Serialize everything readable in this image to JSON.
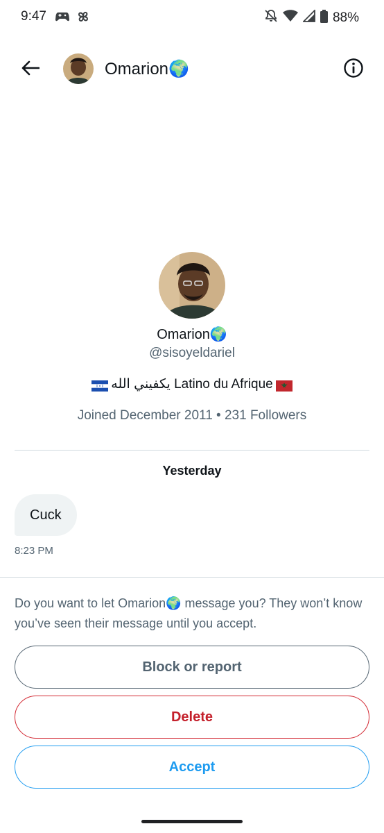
{
  "status_bar": {
    "time": "9:47",
    "battery": "88%",
    "left_icons": [
      "game-controller-icon",
      "pinwheel-icon"
    ],
    "right_icons": [
      "notifications-off-icon",
      "wifi-icon",
      "cell-signal-icon",
      "battery-icon"
    ]
  },
  "header": {
    "name": "Omarion🌍",
    "back_icon": "arrow-left-icon",
    "info_icon": "info-circle-icon"
  },
  "profile": {
    "name": "Omarion🌍",
    "handle": "@sisoyeldariel",
    "bio": "يكفيني الله Latino du Afrique",
    "bio_prefix_flag": "honduras-flag",
    "bio_suffix_flag": "morocco-flag",
    "meta": "Joined December 2011 • 231 Followers"
  },
  "conversation": {
    "date_separator": "Yesterday",
    "messages": [
      {
        "text": "Cuck",
        "time": "8:23 PM"
      }
    ]
  },
  "request": {
    "prompt": "Do you want to let Omarion🌍 message you? They won’t know you’ve seen their message until you accept.",
    "block_label": "Block or report",
    "delete_label": "Delete",
    "accept_label": "Accept"
  },
  "colors": {
    "secondary_text": "#536471",
    "danger": "#c4202b",
    "accent": "#1d9bf0",
    "bubble": "#eff3f4"
  }
}
